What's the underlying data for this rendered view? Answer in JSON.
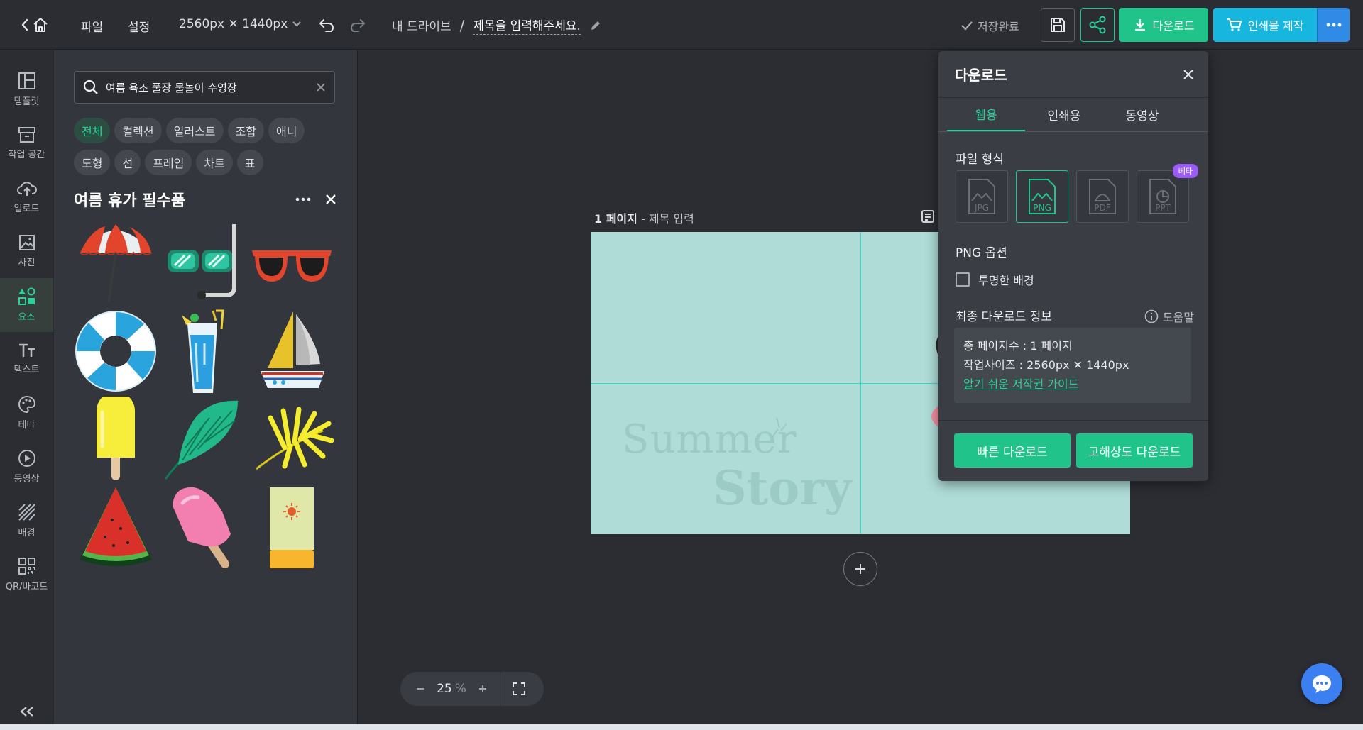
{
  "topbar": {
    "menu_file": "파일",
    "menu_settings": "설정",
    "canvas_size": "2560px ✕ 1440px",
    "breadcrumb_drive": "내 드라이브",
    "breadcrumb_sep": "/",
    "doc_title": "제목을 입력해주세요.",
    "save_status": "저장완료",
    "download_label": "다운로드",
    "print_label": "인쇄물 제작"
  },
  "rail": {
    "items": [
      {
        "label": "템플릿",
        "icon": "template-icon"
      },
      {
        "label": "작업 공간",
        "icon": "workspace-icon"
      },
      {
        "label": "업로드",
        "icon": "upload-icon"
      },
      {
        "label": "사진",
        "icon": "photo-icon"
      },
      {
        "label": "요소",
        "icon": "elements-icon",
        "active": true
      },
      {
        "label": "텍스트",
        "icon": "text-icon"
      },
      {
        "label": "테마",
        "icon": "palette-icon"
      },
      {
        "label": "동영상",
        "icon": "video-icon"
      },
      {
        "label": "배경",
        "icon": "background-icon"
      },
      {
        "label": "QR/바코드",
        "icon": "qr-icon"
      }
    ]
  },
  "panel": {
    "search_value": "여름 욕조 풀장 물놀이 수영장",
    "chips": [
      "전체",
      "컬렉션",
      "일러스트",
      "조합",
      "애니",
      "도형",
      "선",
      "프레임",
      "차트",
      "표"
    ],
    "active_chip": "전체",
    "collection_title": "여름 휴가 필수품",
    "items": [
      {
        "name": "beach-umbrella"
      },
      {
        "name": "snorkel-mask"
      },
      {
        "name": "sunglasses"
      },
      {
        "name": "lifebuoy"
      },
      {
        "name": "cocktail-drink"
      },
      {
        "name": "sailboat"
      },
      {
        "name": "yellow-popsicle"
      },
      {
        "name": "green-palm-leaf"
      },
      {
        "name": "yellow-palm-leaf"
      },
      {
        "name": "watermelon-slice"
      },
      {
        "name": "pink-popsicle"
      },
      {
        "name": "sunscreen-tube"
      }
    ]
  },
  "canvas": {
    "page_number": "1 페이지",
    "page_title_sep": " - ",
    "page_title_placeholder": "제목 입력",
    "summer_text": "Summer",
    "story_text": "Story",
    "zoom_value": "25",
    "zoom_unit": "%"
  },
  "download": {
    "title": "다운로드",
    "tabs": [
      "웹용",
      "인쇄용",
      "동영상"
    ],
    "active_tab": "웹용",
    "file_format_label": "파일 형식",
    "formats": [
      "JPG",
      "PNG",
      "PDF",
      "PPT"
    ],
    "active_format": "PNG",
    "beta_label": "베타",
    "png_options_label": "PNG 옵션",
    "transparent_bg_label": "투명한 배경",
    "final_info_label": "최종 다운로드 정보",
    "help_label": "도움말",
    "total_pages": "총 페이지수 : 1 페이지",
    "work_size": "작업사이즈 : 2560px ✕ 1440px",
    "copyright_link": "알기 쉬운 저작권 가이드",
    "quick_download": "빠른 다운로드",
    "hires_download": "고해상도 다운로드"
  },
  "colors": {
    "accent_green": "#20c38a",
    "accent_cyan": "#16b6de",
    "accent_blue": "#2f8be6",
    "canvas_bg": "#afdcd7",
    "beta_purple": "#9b5cf6"
  }
}
